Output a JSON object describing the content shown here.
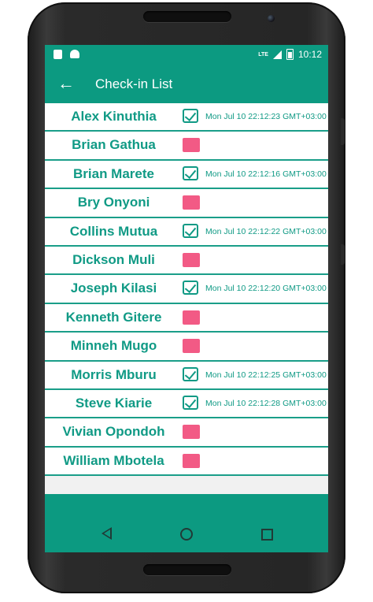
{
  "status_bar": {
    "time": "10:12",
    "network": "LTE"
  },
  "app_bar": {
    "title": "Check-in List"
  },
  "colors": {
    "primary": "#0c9a81",
    "name_text": "#109a85",
    "not_checked": "#f25a85"
  },
  "checkins": [
    {
      "name": "Alex Kinuthia",
      "checked": true,
      "time": "Mon Jul 10 22:12:23 GMT+03:00"
    },
    {
      "name": "Brian Gathua",
      "checked": false,
      "time": ""
    },
    {
      "name": "Brian Marete",
      "checked": true,
      "time": "Mon Jul 10 22:12:16 GMT+03:00"
    },
    {
      "name": "Bry Onyoni",
      "checked": false,
      "time": ""
    },
    {
      "name": "Collins Mutua",
      "checked": true,
      "time": "Mon Jul 10 22:12:22 GMT+03:00"
    },
    {
      "name": "Dickson Muli",
      "checked": false,
      "time": ""
    },
    {
      "name": "Joseph Kilasi",
      "checked": true,
      "time": "Mon Jul 10 22:12:20 GMT+03:00"
    },
    {
      "name": "Kenneth Gitere",
      "checked": false,
      "time": ""
    },
    {
      "name": "Minneh Mugo",
      "checked": false,
      "time": ""
    },
    {
      "name": "Morris Mburu",
      "checked": true,
      "time": "Mon Jul 10 22:12:25 GMT+03:00"
    },
    {
      "name": "Steve Kiarie",
      "checked": true,
      "time": "Mon Jul 10 22:12:28 GMT+03:00"
    },
    {
      "name": "Vivian Opondoh",
      "checked": false,
      "time": ""
    },
    {
      "name": "William Mbotela",
      "checked": false,
      "time": ""
    }
  ]
}
